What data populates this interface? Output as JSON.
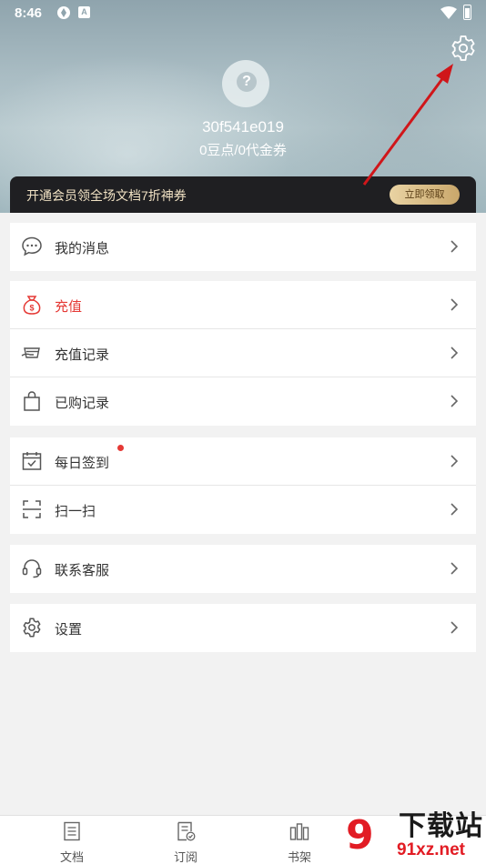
{
  "status_bar": {
    "time": "8:46",
    "notification_badge": "A"
  },
  "profile": {
    "avatar_glyph": "?",
    "username": "30f541e019",
    "points": "0豆点/0代金券"
  },
  "vip_banner": {
    "text": "开通会员领全场文档7折神券",
    "button_label": "立即领取"
  },
  "menu_groups": [
    {
      "items": [
        {
          "icon": "message-icon",
          "label": "我的消息"
        }
      ]
    },
    {
      "items": [
        {
          "icon": "money-bag-icon",
          "label": "充值",
          "accent": "#e53935"
        },
        {
          "icon": "recharge-record-icon",
          "label": "充值记录"
        },
        {
          "icon": "shopping-bag-icon",
          "label": "已购记录"
        }
      ]
    },
    {
      "items": [
        {
          "icon": "calendar-check-icon",
          "label": "每日签到",
          "has_dot": true
        },
        {
          "icon": "scan-icon",
          "label": "扫一扫"
        }
      ]
    },
    {
      "items": [
        {
          "icon": "headset-icon",
          "label": "联系客服"
        }
      ]
    },
    {
      "items": [
        {
          "icon": "gear-icon",
          "label": "设置"
        }
      ]
    }
  ],
  "bottom_nav": [
    {
      "icon": "document-icon",
      "label": "文档"
    },
    {
      "icon": "subscribe-icon",
      "label": "订阅"
    },
    {
      "icon": "bookshelf-icon",
      "label": "书架"
    }
  ],
  "watermark": {
    "logo": "9",
    "title": "下载站",
    "url": "91xz.net"
  },
  "colors": {
    "accent_red": "#e53935",
    "annotation_arrow": "#d0161a",
    "banner_bg": "#1f1f22",
    "banner_button": "#d9bd86"
  }
}
